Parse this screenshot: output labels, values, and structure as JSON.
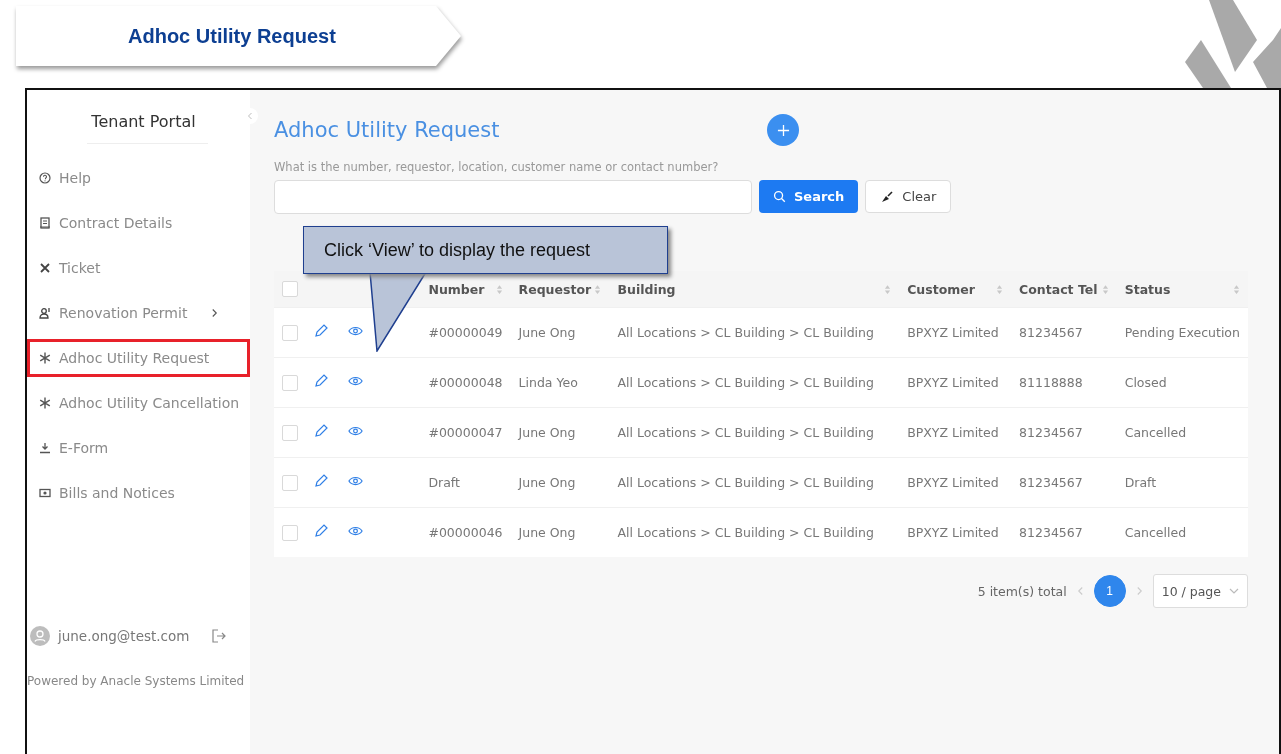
{
  "banner": {
    "title": "Adhoc Utility Request"
  },
  "sidebar": {
    "title": "Tenant Portal",
    "items": [
      {
        "label": "Help",
        "expandable": false,
        "selected": false
      },
      {
        "label": "Contract Details",
        "expandable": false,
        "selected": false
      },
      {
        "label": "Ticket",
        "expandable": false,
        "selected": false
      },
      {
        "label": "Renovation Permit",
        "expandable": true,
        "selected": false
      },
      {
        "label": "Adhoc Utility Request",
        "expandable": false,
        "selected": true
      },
      {
        "label": "Adhoc Utility Cancellation",
        "expandable": false,
        "selected": false
      },
      {
        "label": "E-Form",
        "expandable": false,
        "selected": false
      },
      {
        "label": "Bills and Notices",
        "expandable": false,
        "selected": false
      }
    ],
    "user": "june.ong@test.com",
    "footer": "Powered by Anacle Systems Limited"
  },
  "main": {
    "title": "Adhoc Utility Request",
    "search": {
      "label": "What is the number, requestor, location, customer name or contact number?",
      "search_button": "Search",
      "clear_button": "Clear"
    }
  },
  "callout": {
    "text": "Click ‘View’ to display the request"
  },
  "table": {
    "all_checked": false,
    "columns": [
      "Number",
      "Requestor",
      "Building",
      "Customer",
      "Contact Tel",
      "Status"
    ],
    "rows": [
      {
        "checked": false,
        "cells": [
          "#00000049",
          "June Ong",
          "All Locations > CL Building > CL Building",
          "BPXYZ Limited",
          "81234567",
          "Pending Execution"
        ]
      },
      {
        "checked": false,
        "cells": [
          "#00000048",
          "Linda Yeo",
          "All Locations > CL Building > CL Building",
          "BPXYZ Limited",
          "81118888",
          "Closed"
        ]
      },
      {
        "checked": false,
        "cells": [
          "#00000047",
          "June Ong",
          "All Locations > CL Building > CL Building",
          "BPXYZ Limited",
          "81234567",
          "Cancelled"
        ]
      },
      {
        "checked": false,
        "cells": [
          "Draft",
          "June Ong",
          "All Locations > CL Building > CL Building",
          "BPXYZ Limited",
          "81234567",
          "Draft"
        ]
      },
      {
        "checked": false,
        "cells": [
          "#00000046",
          "June Ong",
          "All Locations > CL Building > CL Building",
          "BPXYZ Limited",
          "81234567",
          "Cancelled"
        ]
      }
    ]
  },
  "pagination": {
    "total": "5 item(s) total",
    "pages": [
      {
        "label": "1",
        "selected": true
      }
    ],
    "page_size": "10 / page"
  }
}
